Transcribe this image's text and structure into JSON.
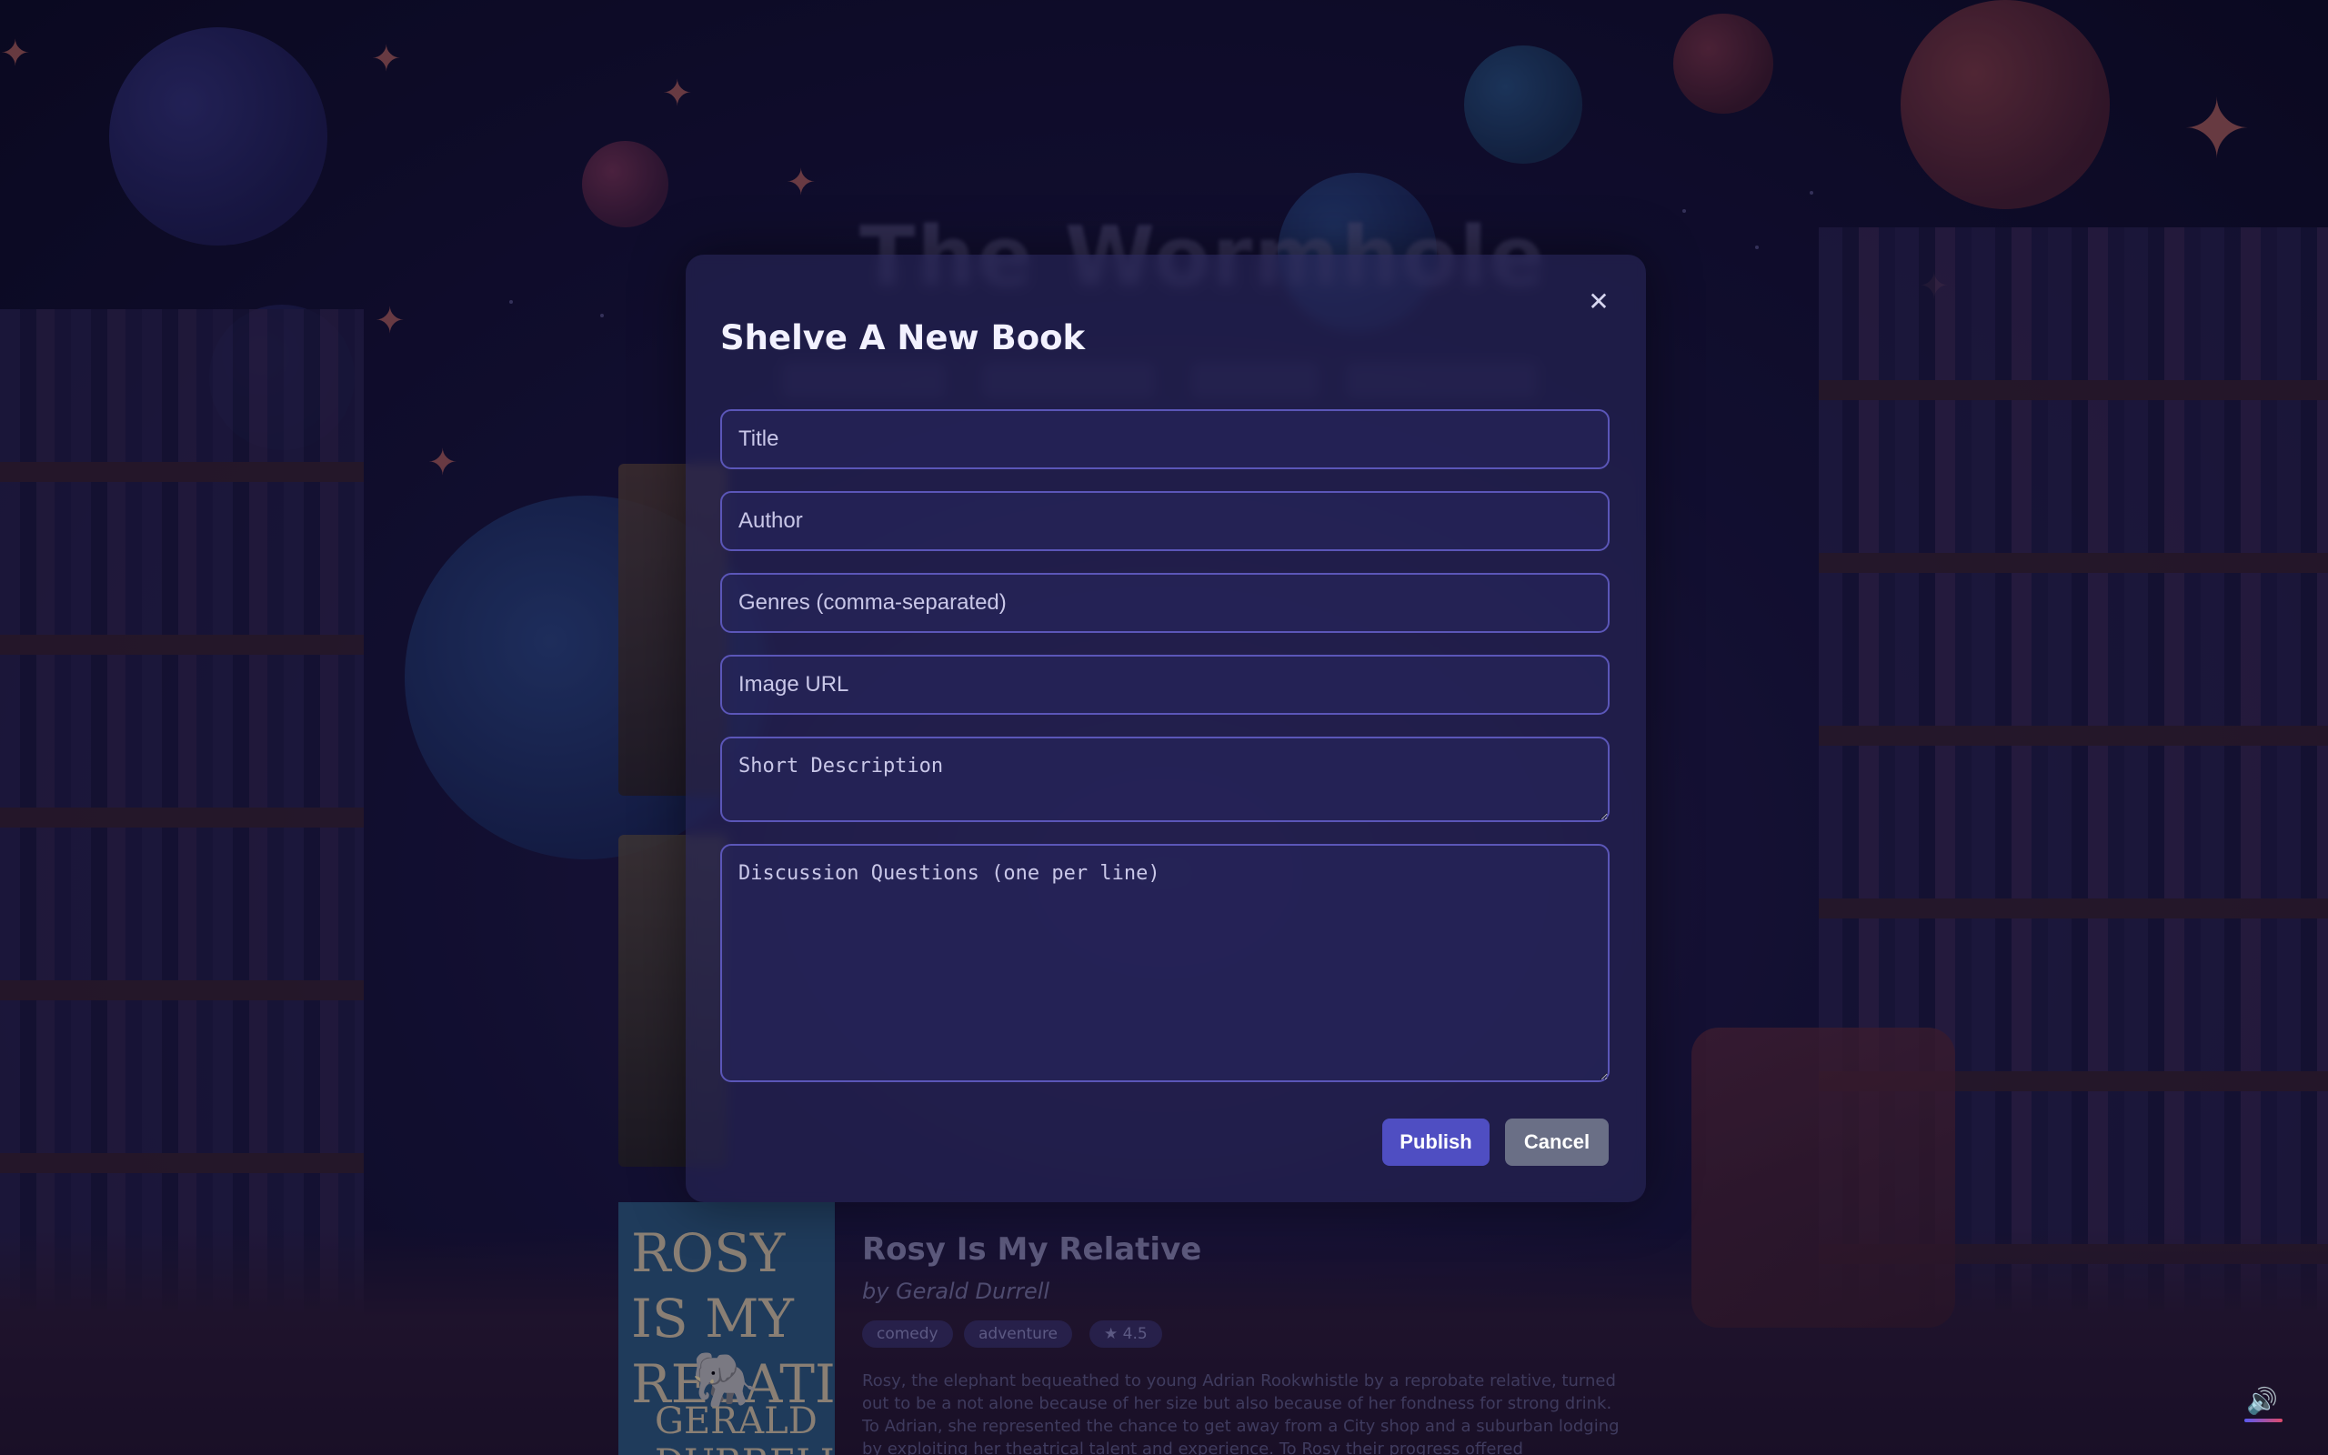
{
  "background": {
    "site_title": "The Wormhole",
    "featured_book": {
      "title": "Rosy Is My Relative",
      "author": "by Gerald Durrell",
      "cover_title": "ROSY IS MY RELATIVE",
      "cover_author": "GERALD DURRELL",
      "genres": [
        "comedy",
        "adventure"
      ],
      "rating": "★ 4.5",
      "description": "Rosy, the elephant bequeathed to young Adrian Rookwhistle by a reprobate relative, turned out to be a not alone because of her size but also because of her fondness for strong drink. To Adrian, she represented the chance to get away from a City shop and a suburban lodging by exploiting her theatrical talent and experience. To Rosy their progress offered undreamed-of opportunities for dri"
    }
  },
  "modal": {
    "title": "Shelve A New Book",
    "close_icon": "close-icon",
    "fields": {
      "title_placeholder": "Title",
      "author_placeholder": "Author",
      "genres_placeholder": "Genres (comma-separated)",
      "image_placeholder": "Image URL",
      "description_placeholder": "Short Description",
      "questions_placeholder": "Discussion Questions (one per line)"
    },
    "buttons": {
      "publish": "Publish",
      "cancel": "Cancel"
    }
  },
  "colors": {
    "publish": "#4f4ec2",
    "cancel": "#6a6f86",
    "field_border": "#5b56b8"
  },
  "sound_icon": "speaker-icon"
}
